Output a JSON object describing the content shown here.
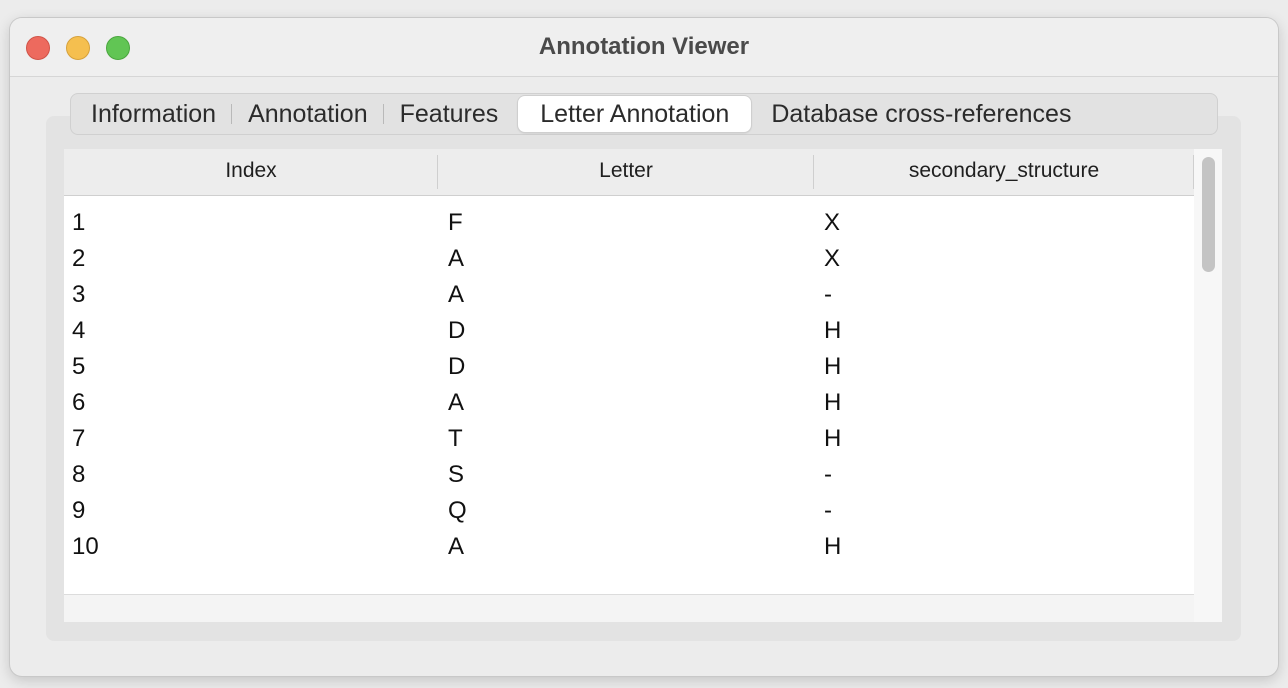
{
  "window": {
    "title": "Annotation Viewer"
  },
  "tabs": [
    {
      "label": "Information",
      "active": false
    },
    {
      "label": "Annotation",
      "active": false
    },
    {
      "label": "Features",
      "active": false
    },
    {
      "label": "Letter Annotation",
      "active": true
    },
    {
      "label": "Database cross-references",
      "active": false
    }
  ],
  "table": {
    "columns": [
      "Index",
      "Letter",
      "secondary_structure"
    ],
    "rows": [
      [
        "1",
        "F",
        "X"
      ],
      [
        "2",
        "A",
        "X"
      ],
      [
        "3",
        "A",
        "-"
      ],
      [
        "4",
        "D",
        "H"
      ],
      [
        "5",
        "D",
        "H"
      ],
      [
        "6",
        "A",
        "H"
      ],
      [
        "7",
        "T",
        "H"
      ],
      [
        "8",
        "S",
        "-"
      ],
      [
        "9",
        "Q",
        "-"
      ],
      [
        "10",
        "A",
        "H"
      ]
    ]
  },
  "colors": {
    "close": "#ed6a5e",
    "minimize": "#f5bf4f",
    "maximize": "#61c554"
  }
}
